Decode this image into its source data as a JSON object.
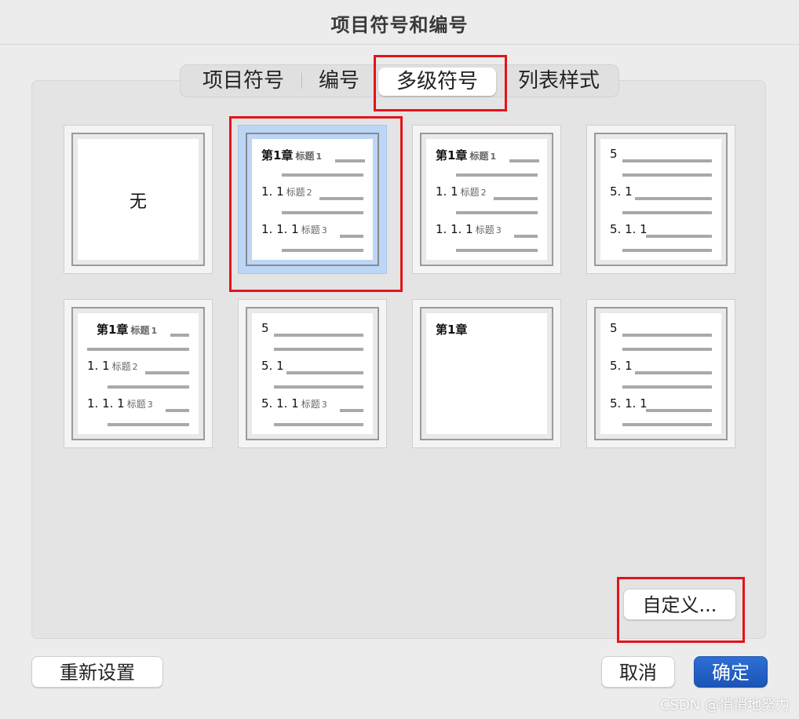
{
  "dialog": {
    "title": "项目符号和编号"
  },
  "tabs": [
    {
      "label": "项目符号",
      "selected": false
    },
    {
      "label": "编号",
      "selected": false
    },
    {
      "label": "多级符号",
      "selected": true
    },
    {
      "label": "列表样式",
      "selected": false
    }
  ],
  "presets": [
    {
      "type": "none",
      "label": "无",
      "selected": false
    },
    {
      "type": "chapter",
      "selected": true,
      "lines": [
        {
          "text": "第1章",
          "lbl": "标题",
          "num": "1"
        },
        {
          "text": "1. 1",
          "lbl": "标题",
          "num": "2"
        },
        {
          "text": "1. 1. 1",
          "lbl": "标题",
          "num": "3"
        }
      ]
    },
    {
      "type": "chapter",
      "selected": false,
      "lines": [
        {
          "text": "第1章",
          "lbl": "标题",
          "num": "1"
        },
        {
          "text": "1. 1",
          "lbl": "标题",
          "num": "2"
        },
        {
          "text": "1. 1. 1",
          "lbl": "标题",
          "num": "3"
        }
      ]
    },
    {
      "type": "numbered",
      "selected": false,
      "lines": [
        {
          "text": "5"
        },
        {
          "text": "5. 1"
        },
        {
          "text": "5. 1. 1"
        }
      ]
    },
    {
      "type": "chapter-indent",
      "selected": false,
      "lines": [
        {
          "text": "第1章",
          "lbl": "标题",
          "num": "1"
        },
        {
          "text": "1. 1",
          "lbl": "标题",
          "num": "2"
        },
        {
          "text": "1. 1. 1",
          "lbl": "标题",
          "num": "3"
        }
      ]
    },
    {
      "type": "numbered-mixed",
      "selected": false,
      "lines": [
        {
          "text": "5"
        },
        {
          "text": "5. 1"
        },
        {
          "text": "5. 1. 1",
          "lbl": "标题",
          "num": "3"
        }
      ]
    },
    {
      "type": "single",
      "selected": false,
      "lines": [
        {
          "text": "第1章"
        }
      ]
    },
    {
      "type": "numbered",
      "selected": false,
      "lines": [
        {
          "text": "5"
        },
        {
          "text": "5. 1"
        },
        {
          "text": "5. 1. 1"
        }
      ]
    }
  ],
  "buttons": {
    "customize": "自定义...",
    "reset": "重新设置",
    "cancel": "取消",
    "ok": "确定"
  },
  "watermark": "CSDN @悄悄地努力",
  "colors": {
    "highlight": "#e3131b",
    "selection": "#bcd6f6",
    "primary": "#1f5fc6"
  }
}
